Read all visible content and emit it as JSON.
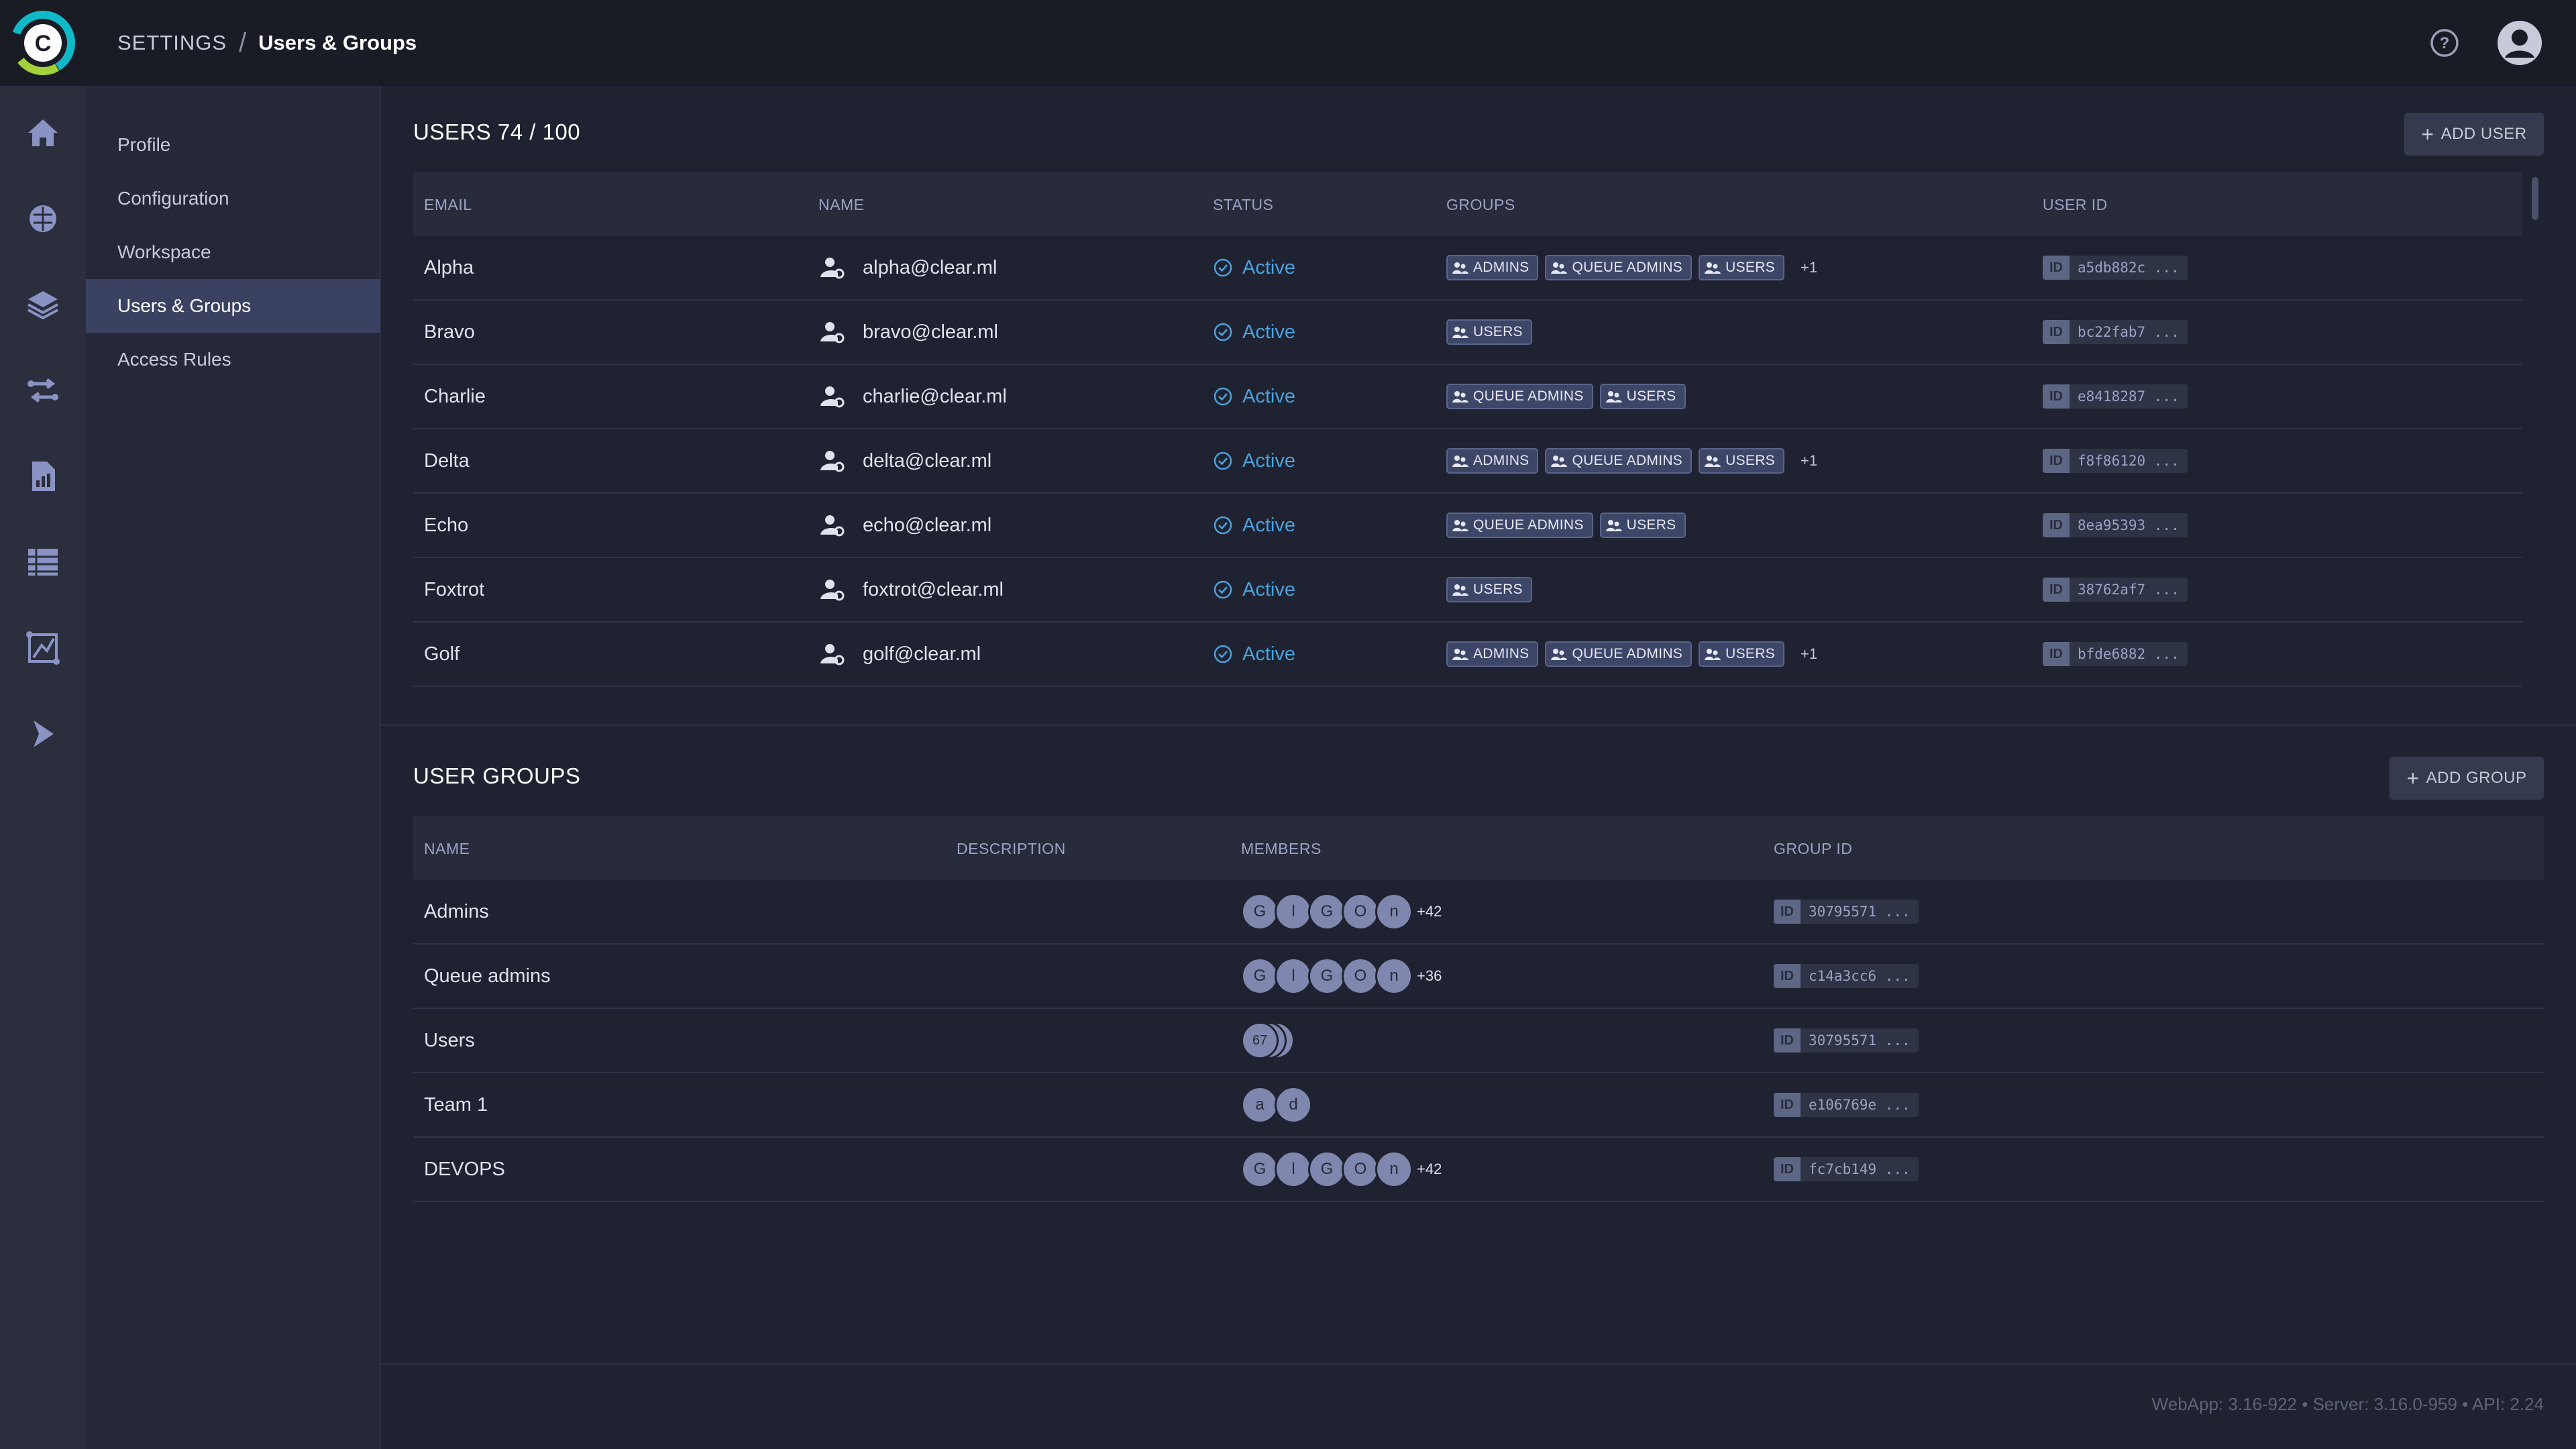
{
  "header": {
    "breadcrumb_root": "SETTINGS",
    "breadcrumb_separator": "/",
    "breadcrumb_current": "Users & Groups",
    "logo_letter": "C"
  },
  "rail": {
    "items": [
      "home-icon",
      "brain-icon",
      "layers-icon",
      "pipelines-icon",
      "reports-icon",
      "datasets-icon",
      "model-icon",
      "deploy-icon"
    ]
  },
  "subnav": {
    "items": [
      {
        "label": "Profile",
        "active": false
      },
      {
        "label": "Configuration",
        "active": false
      },
      {
        "label": "Workspace",
        "active": false
      },
      {
        "label": "Users & Groups",
        "active": true
      },
      {
        "label": "Access Rules",
        "active": false
      }
    ]
  },
  "users": {
    "title": "USERS 74 / 100",
    "add_label": "ADD USER",
    "columns": {
      "email": "EMAIL",
      "name": "NAME",
      "status": "STATUS",
      "groups": "GROUPS",
      "user_id": "USER ID"
    },
    "rows": [
      {
        "email": "Alpha",
        "name": "alpha@clear.ml",
        "status": "Active",
        "groups": [
          "ADMINS",
          "QUEUE ADMINS",
          "USERS"
        ],
        "more": "+1",
        "id": "a5db882c ..."
      },
      {
        "email": "Bravo",
        "name": "bravo@clear.ml",
        "status": "Active",
        "groups": [
          "USERS"
        ],
        "more": "",
        "id": "bc22fab7 ..."
      },
      {
        "email": "Charlie",
        "name": "charlie@clear.ml",
        "status": "Active",
        "groups": [
          "QUEUE ADMINS",
          "USERS"
        ],
        "more": "",
        "id": "e8418287 ..."
      },
      {
        "email": "Delta",
        "name": "delta@clear.ml",
        "status": "Active",
        "groups": [
          "ADMINS",
          "QUEUE ADMINS",
          "USERS"
        ],
        "more": "+1",
        "id": "f8f86120 ..."
      },
      {
        "email": "Echo",
        "name": "echo@clear.ml",
        "status": "Active",
        "groups": [
          "QUEUE ADMINS",
          "USERS"
        ],
        "more": "",
        "id": "8ea95393 ..."
      },
      {
        "email": "Foxtrot",
        "name": "foxtrot@clear.ml",
        "status": "Active",
        "groups": [
          "USERS"
        ],
        "more": "",
        "id": "38762af7 ..."
      },
      {
        "email": "Golf",
        "name": "golf@clear.ml",
        "status": "Active",
        "groups": [
          "ADMINS",
          "QUEUE ADMINS",
          "USERS"
        ],
        "more": "+1",
        "id": "bfde6882 ..."
      }
    ]
  },
  "groups": {
    "title": "USER GROUPS",
    "add_label": "ADD GROUP",
    "columns": {
      "name": "NAME",
      "description": "DESCRIPTION",
      "members": "MEMBERS",
      "group_id": "GROUP ID"
    },
    "rows": [
      {
        "name": "Admins",
        "description": "",
        "members": [
          "G",
          "l",
          "G",
          "O",
          "n"
        ],
        "count": "+42",
        "stacked": "",
        "id": "30795571 ..."
      },
      {
        "name": "Queue admins",
        "description": "",
        "members": [
          "G",
          "l",
          "G",
          "O",
          "n"
        ],
        "count": "+36",
        "stacked": "",
        "id": "c14a3cc6 ..."
      },
      {
        "name": "Users",
        "description": "",
        "members": [],
        "count": "",
        "stacked": "67",
        "id": "30795571 ..."
      },
      {
        "name": "Team 1",
        "description": "",
        "members": [
          "a",
          "d"
        ],
        "count": "",
        "stacked": "",
        "id": "e106769e ..."
      },
      {
        "name": "DEVOPS",
        "description": "",
        "members": [
          "G",
          "l",
          "G",
          "O",
          "n"
        ],
        "count": "+42",
        "stacked": "",
        "id": "fc7cb149 ..."
      }
    ]
  },
  "id_badge": "ID",
  "footer": "WebApp: 3.16-922 • Server: 3.16.0-959 • API: 2.24",
  "colors": {
    "accent": "#4aa3df",
    "active_nav": "#3b4261",
    "tag_bg": "#3e4668"
  }
}
